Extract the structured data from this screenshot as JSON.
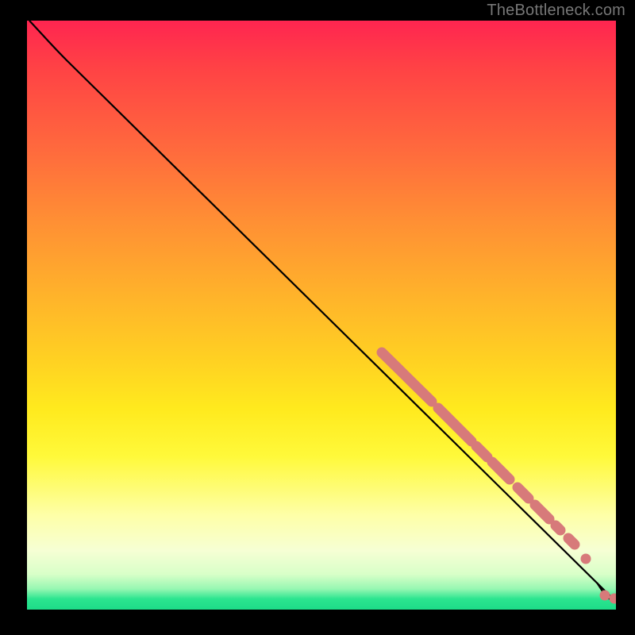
{
  "attribution": "TheBottleneck.com",
  "chart_data": {
    "type": "line",
    "title": "",
    "xlabel": "",
    "ylabel": "",
    "xlim": [
      0,
      100
    ],
    "ylim": [
      0,
      100
    ],
    "curve": {
      "x": [
        0,
        3,
        6,
        10,
        20,
        30,
        40,
        50,
        60,
        70,
        80,
        88,
        93,
        96,
        98,
        100
      ],
      "y": [
        100,
        98,
        96,
        93.5,
        83.8,
        73.8,
        63.8,
        53.8,
        43.8,
        33.8,
        23.8,
        15.8,
        10.8,
        7.3,
        3.5,
        1.8
      ]
    },
    "marker_series": {
      "name": "segments",
      "color": "#d77a7a",
      "points_x": [
        60,
        61,
        62,
        63,
        64,
        65,
        66,
        67,
        68,
        69,
        70,
        72,
        73,
        74,
        75,
        76,
        77,
        79,
        80,
        81,
        84,
        85,
        86,
        88,
        89,
        90,
        92,
        94,
        96,
        98,
        100
      ],
      "points_y": [
        43.8,
        42.8,
        41.8,
        40.8,
        39.8,
        38.8,
        37.8,
        36.8,
        35.8,
        34.8,
        33.8,
        31.8,
        30.8,
        29.8,
        28.8,
        27.8,
        26.8,
        24.8,
        23.8,
        22.8,
        19.8,
        18.8,
        17.8,
        15.8,
        14.8,
        13.8,
        11.8,
        9.8,
        7.3,
        3.5,
        1.8
      ]
    }
  }
}
